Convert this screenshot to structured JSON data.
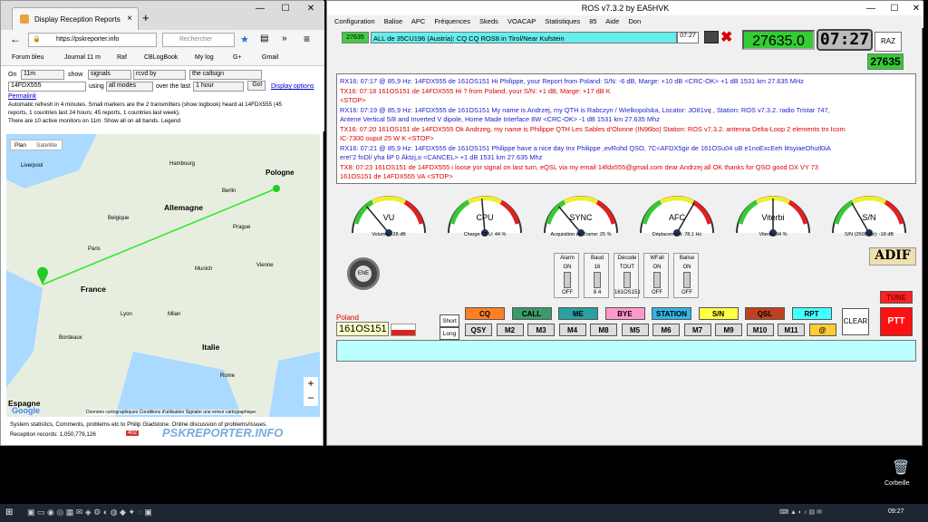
{
  "browser": {
    "tab_title": "Display Reception Reports",
    "url": "https://pskreporter.info",
    "search_placeholder": "Rechercher",
    "bookmarks": [
      "Forum bleu",
      "Journal 11 m",
      "Raf",
      "CBLogBook",
      "My log",
      "G+",
      "Gmail"
    ]
  },
  "psk": {
    "on_label": "On",
    "band": "11m",
    "show_label": "show",
    "show_value": "signals",
    "rcvd_by": "rcvd by",
    "callsign_mode": "the callsign",
    "callsign": "14FDX555",
    "using_label": "using",
    "mode": "all modes",
    "over_label": "over the last",
    "period": "1 hour",
    "go": "Go!",
    "display_options": "Display options",
    "permalink": "Permalink",
    "info1": "Automatic refresh in 4 minutes. Small markers are the 2 transmitters (show logbook) heard at 14FDX555 (45",
    "info2": "reports, 1 countries last 24 hours; 45 reports, 1 countries last week).",
    "info3": "There are 10 active monitors on 11m. Show all on all bands. Legend",
    "footer1": "System statistics, Comments, problems etc to Philip Gladstone. Online discussion of problems/issues.",
    "footer2": "Reception records: 1,050,779,126",
    "footer_badge": "402",
    "brand": "PSKREPORTER.INFO"
  },
  "map": {
    "tab_plan": "Plan",
    "tab_sat": "Satellite",
    "labels": [
      "Pologne",
      "Allemagne",
      "France",
      "Italie",
      "Espagne",
      "Belgique",
      "Liverpool",
      "Berlin",
      "Paris",
      "Munich",
      "Vienne",
      "Milan",
      "Rome",
      "Lyon",
      "Bordeaux",
      "Prague",
      "Hambourg",
      "Google"
    ],
    "copyright": "Données cartographiques  Conditions d'utilisation  Signaler une erreur cartographique"
  },
  "ros": {
    "title": "ROS v7.3.2 by EA5HVK",
    "menu": [
      "Configuration",
      "Balise",
      "APC",
      "Fréquences",
      "Skeds",
      "VOACAP",
      "Statistiques",
      "85",
      "Aide",
      "Don"
    ],
    "freq_small": "27635",
    "alert": "ALL de 35CU196 (Austria): CQ CQ ROS8 in Tirol/Near Kufstein",
    "alert_time": "07:27",
    "freq": "27635.0",
    "clock": "07:27",
    "raz": "RAZ",
    "freq2": "27635",
    "messages": [
      {
        "c": "blue",
        "t": "RX16: 07:17 @ 85,9 Hz: 14FDX555 de 161OS151 Hi Philippe, your Report from Poland: S/N: -6 dB, Marge: +10 dB  <CRC-OK> +1 dB  1531 km  27.635 MHz"
      },
      {
        "c": "red",
        "t": "TX16: 07:18 161OS151 de 14FDX555 Hi ? from Poland, your S/N: +1 dB, Marge: +17 dB K"
      },
      {
        "c": "red",
        "t": "  <STOP>"
      },
      {
        "c": "blue",
        "t": "RX16: 07:19 @ 85,9 Hz: 14FDX555 de 161OS151 My name is Andrzej, my QTH is Rabczyn / Wielkopolska, Locator: JO81vq , Station: ROS v7.3.2. radio Tristar 747,"
      },
      {
        "c": "blue",
        "t": "Antene Vertical 5/8 and Inverted V dipole, Home Made Interface 8W <CRC-OK> -1 dB  1531 km  27.635 Mhz"
      },
      {
        "c": "red",
        "t": "TX16: 07:20 161OS151 de 14FDX555 Ok Andrzeg, my name is Philippe QTH Les Sables d'Olonne (IN96bo) Station: ROS v7.3.2. antenna Delta-Loop 2 elements trx Icom"
      },
      {
        "c": "red",
        "t": "IC-7300 ouput 25 W K <STOP>"
      },
      {
        "c": "blue",
        "t": "RX16: 07:21 @ 85,9 Hz: 14FDX555 de 161OS151 Philippe have a nice day tnx Philippe ,evRohd QSO, 7C<AFDX5gir de 161OSu04 uB e1noExcEeh l#syiaeOhutl0iA"
      },
      {
        "c": "blue",
        "t": "ere!'2  fnDl/ yha liP 0 Äktzj,o <CANCEL> +1 dB  1531 km  27.635 Mhz"
      },
      {
        "c": "red",
        "t": "TX8: 07:23 161OS151 de 14FDX555 i loose yor signal on last turn, eQSL via my email 14fdx555@gmail.com dear Andrzej all OK thanks for QSO good DX VY 73"
      },
      {
        "c": "red",
        "t": "161OS151 de 14FDX555 VA    <STOP>"
      }
    ],
    "gauges": [
      {
        "name": "VU",
        "sub": "Volume: -28 dB",
        "needle": -40
      },
      {
        "name": "CPU",
        "sub": "Charge CPU: 44 %",
        "needle": -5
      },
      {
        "name": "SYNC",
        "sub": "Acquisition de Trame: 25 %",
        "needle": -40
      },
      {
        "name": "AFC",
        "sub": "Déplacement: 78,1 Hz",
        "needle": 30
      },
      {
        "name": "Viterbi",
        "sub": "Viterbi: 94 %",
        "needle": 0
      },
      {
        "name": "S/N",
        "sub": "S/N (2500 Hz): -18 dB",
        "needle": -30
      }
    ],
    "adif": "ADIF",
    "ene": "ENE",
    "switches": [
      {
        "t": "Alarm",
        "a": "ON",
        "b": "OFF"
      },
      {
        "t": "Baud",
        "a": "16",
        "b": "8 4"
      },
      {
        "t": "Décode",
        "a": "TOUT",
        "b": "161OS151"
      },
      {
        "t": "WFall",
        "a": "ON",
        "b": "OFF"
      },
      {
        "t": "Balise",
        "a": "ON",
        "b": "OFF"
      }
    ],
    "country": "Poland",
    "callsign": "161OS151",
    "short": "Short",
    "long": "Long",
    "macro_top": [
      {
        "l": "CQ",
        "c": "#ff7f27"
      },
      {
        "l": "CALL",
        "c": "#3a9a6a"
      },
      {
        "l": "ME",
        "c": "#2aa0a0"
      },
      {
        "l": "BYE",
        "c": "#ff99cc"
      },
      {
        "l": "STATION",
        "c": "#33b5e5"
      },
      {
        "l": "S/N",
        "c": "#ffff44"
      },
      {
        "l": "QSL",
        "c": "#c04020"
      },
      {
        "l": "RPT",
        "c": "#44ffff"
      }
    ],
    "macro_bot": [
      "QSY",
      "M2",
      "M3",
      "M4",
      "M8",
      "M5",
      "M6",
      "M7",
      "M9",
      "M10",
      "M11",
      "@"
    ],
    "clear": "CLEAR",
    "tune": "TUNE",
    "ptt": "PTT"
  },
  "desktop": {
    "recycle": "Corbeille",
    "time": "09:27"
  }
}
